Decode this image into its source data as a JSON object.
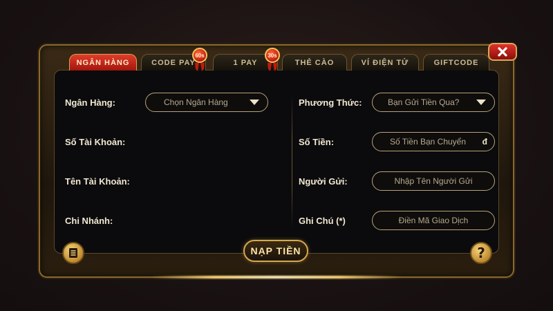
{
  "tabs": [
    {
      "label": "NGÂN HÀNG",
      "active": true
    },
    {
      "label": "CODE PAY",
      "badge": "60s"
    },
    {
      "label": "1 PAY",
      "badge": "30s"
    },
    {
      "label": "THẺ CÀO"
    },
    {
      "label": "VÍ ĐIỆN TỬ"
    },
    {
      "label": "GIFTCODE"
    }
  ],
  "form": {
    "left": {
      "bank_label": "Ngân Hàng:",
      "bank_select_value": "Chọn Ngân Hàng",
      "account_number_label": "Số Tài Khoản:",
      "account_name_label": "Tên Tài Khoản:",
      "branch_label": "Chi Nhánh:"
    },
    "right": {
      "method_label": "Phương Thức:",
      "method_select_value": "Bạn Gửi Tiền Qua?",
      "amount_label": "Số Tiền:",
      "amount_placeholder": "Số Tiền Bạn Chuyển",
      "currency_symbol": "đ",
      "sender_label": "Người Gửi:",
      "sender_placeholder": "Nhập Tên Người Gửi",
      "note_label": "Ghi Chú (*)",
      "note_placeholder": "Điền Mã Giao Dịch"
    }
  },
  "actions": {
    "submit_label": "NẠP TIỀN",
    "help_symbol": "?"
  },
  "icons": {
    "close": "close-icon",
    "history": "document-icon",
    "help": "help-icon"
  },
  "colors": {
    "accent_gold": "#d7a84e",
    "active_tab_red": "#c8251a"
  }
}
